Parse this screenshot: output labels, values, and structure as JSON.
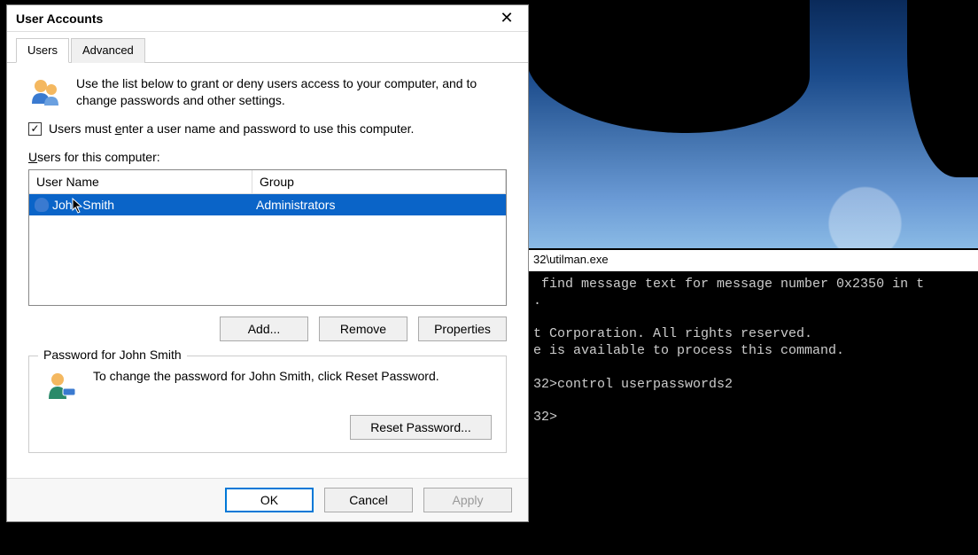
{
  "background": {
    "terminal_title_fragment": "32\\utilman.exe",
    "terminal_lines": " find message text for message number 0x2350 in t\n.\n\nt Corporation. All rights reserved.\ne is available to process this command.\n\n32>control userpasswords2\n\n32>"
  },
  "dialog": {
    "title": "User Accounts",
    "close_glyph": "✕",
    "tabs": {
      "users": "Users",
      "advanced": "Advanced"
    },
    "intro": "Use the list below to grant or deny users access to your computer, and to change passwords and other settings.",
    "checkbox_label_pre": "Users must ",
    "checkbox_label_ul": "e",
    "checkbox_label_post": "nter a user name and password to use this computer.",
    "checkbox_checked_glyph": "✓",
    "list_label_ul": "U",
    "list_label_post": "sers for this computer:",
    "columns": {
      "user": "User Name",
      "group": "Group"
    },
    "rows": [
      {
        "user": "John Smith",
        "group": "Administrators"
      }
    ],
    "buttons": {
      "add": "Add...",
      "remove": "Remove",
      "properties": "Properties"
    },
    "password_group_title": "Password for John Smith",
    "password_text": "To change the password for John Smith, click Reset Password.",
    "reset_password": "Reset Password...",
    "footer": {
      "ok": "OK",
      "cancel": "Cancel",
      "apply": "Apply"
    }
  }
}
